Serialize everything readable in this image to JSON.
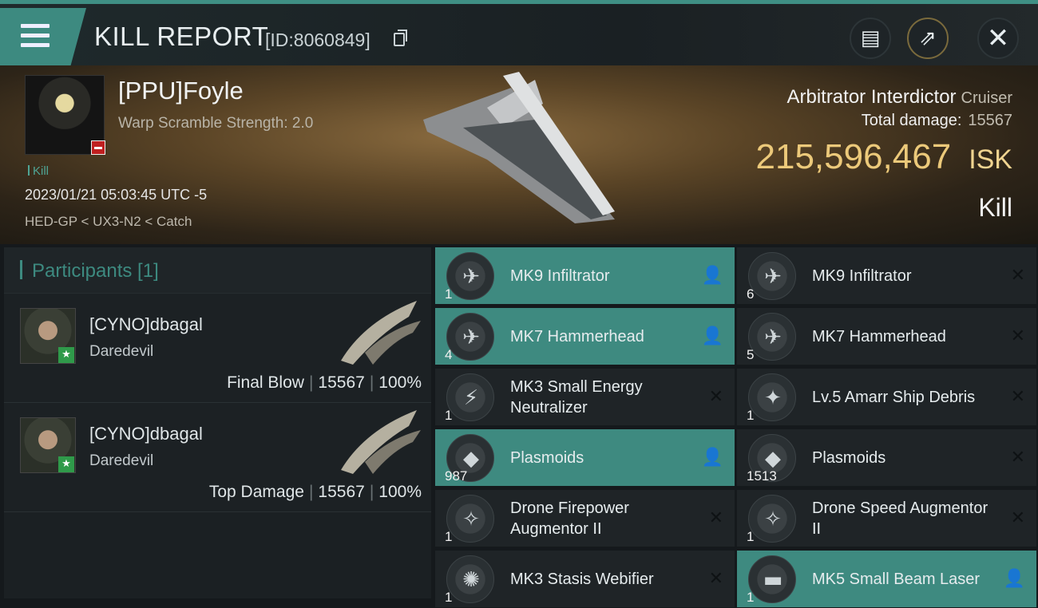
{
  "header": {
    "title": "KILL REPORT",
    "report_id": "[ID:8060849]"
  },
  "icons": {
    "menu": "menu-icon",
    "copy": "copy-icon",
    "clipboard": "clipboard-icon",
    "share": "share-icon",
    "close": "close-icon"
  },
  "victim": {
    "name": "[PPU]Foyle",
    "stat": "Warp Scramble Strength: 2.0",
    "tag": "Kill",
    "datetime": "2023/01/21 05:03:45 UTC -5",
    "route": "HED-GP < UX3-N2 < Catch"
  },
  "ship": {
    "name": "Arbitrator Interdictor",
    "class": "Cruiser",
    "total_damage_label": "Total damage:",
    "total_damage": "15567",
    "isk_value": "215,596,467",
    "isk_unit": "ISK",
    "result": "Kill"
  },
  "participants": {
    "header": "Participants [1]",
    "rows": [
      {
        "name": "[CYNO]dbagal",
        "ship": "Daredevil",
        "role": "Final Blow",
        "damage": "15567",
        "percent": "100%"
      },
      {
        "name": "[CYNO]dbagal",
        "ship": "Daredevil",
        "role": "Top Damage",
        "damage": "15567",
        "percent": "100%"
      }
    ]
  },
  "items": [
    {
      "name": "MK9  Infiltrator",
      "qty": "1",
      "dropped": true,
      "glyph": "✈"
    },
    {
      "name": "MK9  Infiltrator",
      "qty": "6",
      "dropped": false,
      "glyph": "✈"
    },
    {
      "name": "MK7  Hammerhead",
      "qty": "4",
      "dropped": true,
      "glyph": "✈"
    },
    {
      "name": "MK7  Hammerhead",
      "qty": "5",
      "dropped": false,
      "glyph": "✈"
    },
    {
      "name": "MK3 Small Energy Neutralizer",
      "qty": "1",
      "dropped": false,
      "glyph": "⚡"
    },
    {
      "name": "Lv.5 Amarr Ship Debris",
      "qty": "1",
      "dropped": false,
      "glyph": "✦"
    },
    {
      "name": "Plasmoids",
      "qty": "987",
      "dropped": true,
      "glyph": "◆"
    },
    {
      "name": "Plasmoids",
      "qty": "1513",
      "dropped": false,
      "glyph": "◆"
    },
    {
      "name": "Drone Firepower Augmentor II",
      "qty": "1",
      "dropped": false,
      "glyph": "✧"
    },
    {
      "name": "Drone Speed Augmentor II",
      "qty": "1",
      "dropped": false,
      "glyph": "✧"
    },
    {
      "name": "MK3 Stasis Webifier",
      "qty": "1",
      "dropped": false,
      "glyph": "✺"
    },
    {
      "name": "MK5 Small Beam Laser",
      "qty": "1",
      "dropped": true,
      "glyph": "▬"
    }
  ]
}
